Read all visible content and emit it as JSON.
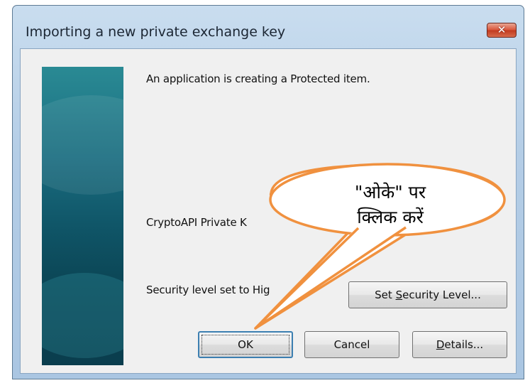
{
  "window": {
    "title": "Importing a new private exchange key",
    "close_glyph": "✕"
  },
  "dialog": {
    "message": "An application is creating a Protected item.",
    "item_label": "CryptoAPI Private K",
    "security_text": "Security level set to Hig",
    "set_security_button": "Set Security Level...",
    "set_security_accel": "S",
    "ok_button": "OK",
    "cancel_button": "Cancel",
    "details_button": "Details...",
    "details_accel": "D"
  },
  "callout": {
    "line1": "\"ओके\" पर",
    "line2": "क्लिक करें",
    "fill": "#ffffff",
    "stroke": "#f0913f"
  },
  "colors": {
    "banner": "#0f5466",
    "window_frame": "#b4cde6",
    "client_bg": "#f0f0f0",
    "close_button": "#d9563b"
  }
}
